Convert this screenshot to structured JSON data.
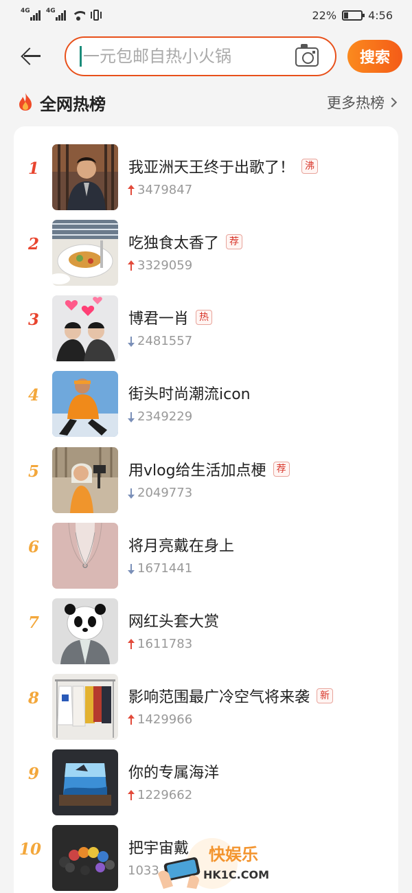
{
  "status_bar": {
    "network_1": "4G",
    "network_2": "4G",
    "battery_percent": "22%",
    "battery_level": 0.22,
    "time": "4:56"
  },
  "search": {
    "placeholder": "一元包邮自热小火锅",
    "button_label": "搜索",
    "accent_color": "#e8501a"
  },
  "header": {
    "title": "全网热榜",
    "more_label": "更多热榜"
  },
  "colors": {
    "rank_top": "#e8442e",
    "rank_rest": "#f3a73b",
    "trend_up": "#e24a3a",
    "trend_down": "#7a8fb8"
  },
  "items": [
    {
      "rank": "1",
      "title": "我亚洲天王终于出歌了！",
      "badge": "沸",
      "trend": "up",
      "count": "3479847",
      "thumb": "man-portrait"
    },
    {
      "rank": "2",
      "title": "吃独食太香了",
      "badge": "荐",
      "trend": "up",
      "count": "3329059",
      "thumb": "food-plate"
    },
    {
      "rank": "3",
      "title": "博君一肖",
      "badge": "热",
      "trend": "down",
      "count": "2481557",
      "thumb": "hearts-duo"
    },
    {
      "rank": "4",
      "title": "街头时尚潮流icon",
      "badge": "",
      "trend": "down",
      "count": "2349229",
      "thumb": "street-fashion"
    },
    {
      "rank": "5",
      "title": "用vlog给生活加点梗",
      "badge": "荐",
      "trend": "down",
      "count": "2049773",
      "thumb": "vlog-girl"
    },
    {
      "rank": "6",
      "title": "将月亮戴在身上",
      "badge": "",
      "trend": "down",
      "count": "1671441",
      "thumb": "moon-necklace"
    },
    {
      "rank": "7",
      "title": "网红头套大赏",
      "badge": "",
      "trend": "up",
      "count": "1611783",
      "thumb": "panda-mask"
    },
    {
      "rank": "8",
      "title": "影响范围最广冷空气将来袭",
      "badge": "新",
      "trend": "up",
      "count": "1429966",
      "thumb": "clothes-rack"
    },
    {
      "rank": "9",
      "title": "你的专属海洋",
      "badge": "",
      "trend": "up",
      "count": "1229662",
      "thumb": "ocean-resin"
    },
    {
      "rank": "10",
      "title": "把宇宙戴",
      "badge": "",
      "trend": "",
      "count": "1033",
      "thumb": "planet-bracelet"
    }
  ],
  "watermark": {
    "text": "快娱乐",
    "sub": "HK1C.COM"
  }
}
